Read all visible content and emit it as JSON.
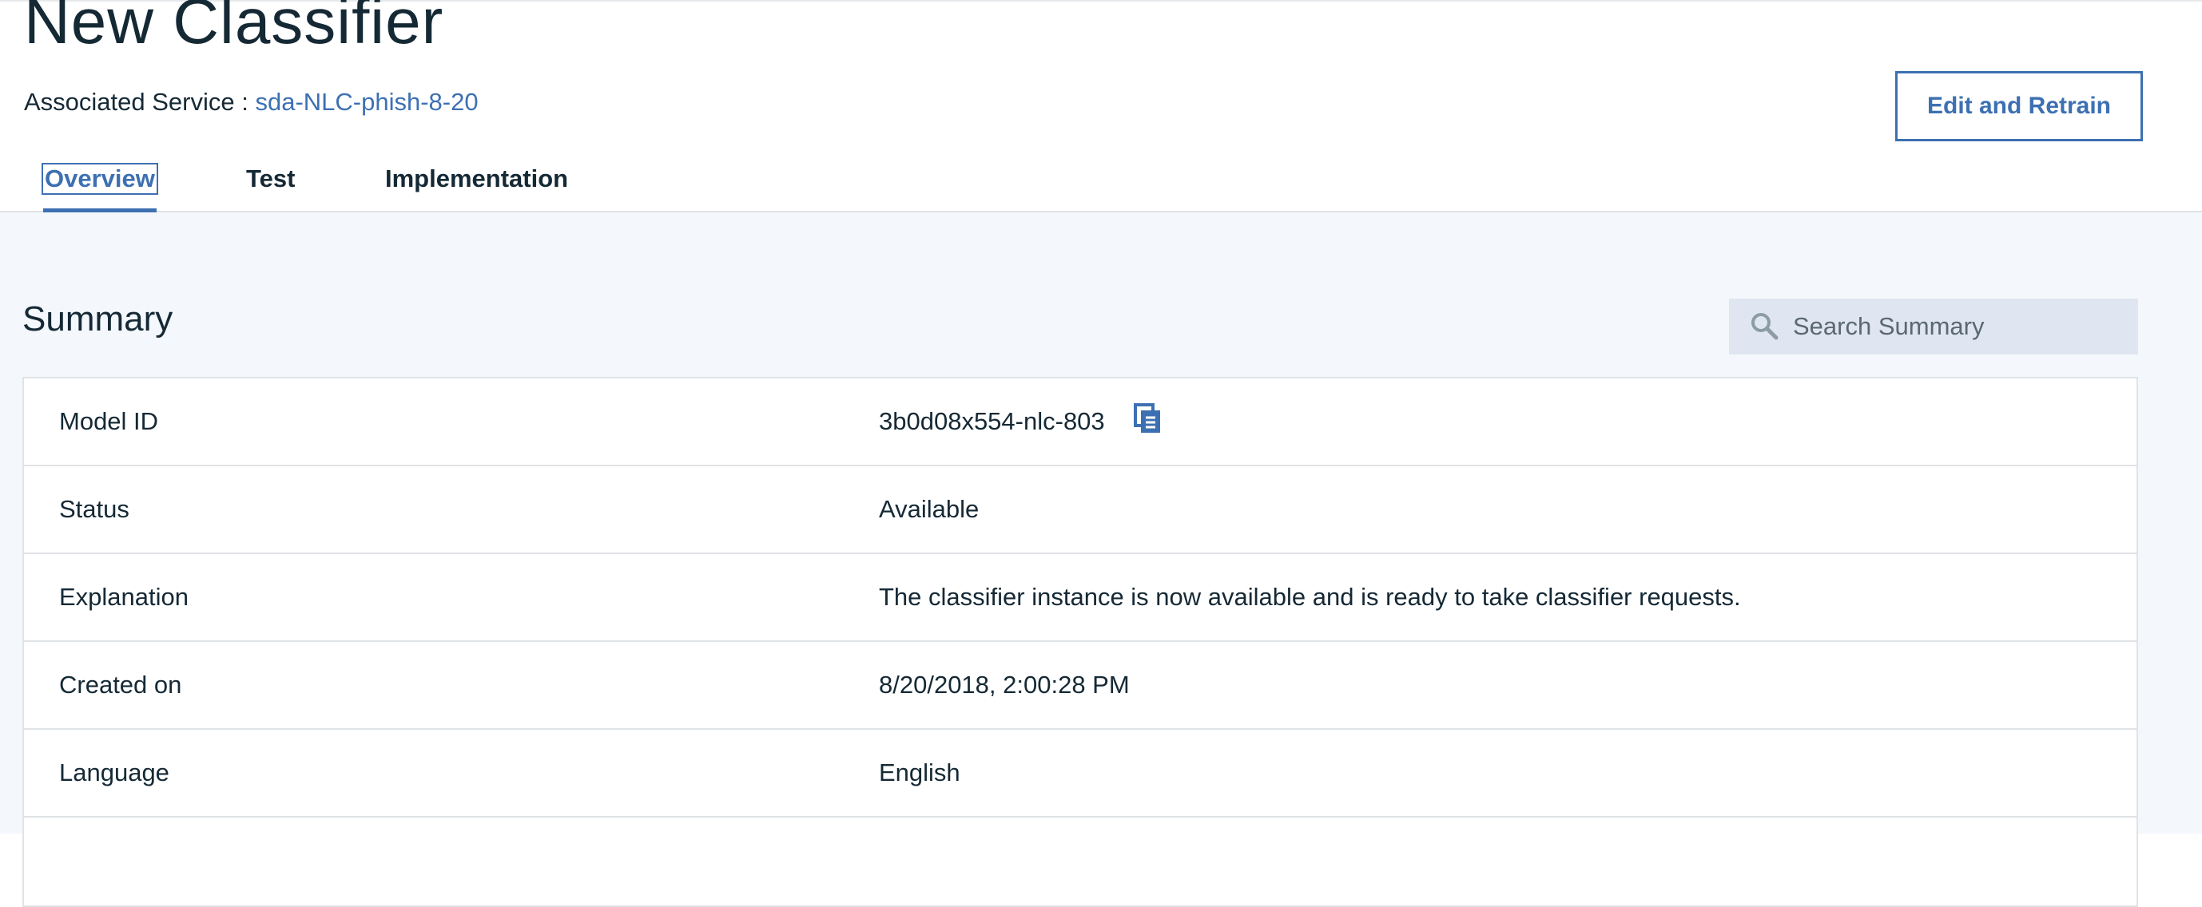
{
  "header": {
    "title": "New Classifier",
    "associated_service_label": "Associated Service : ",
    "associated_service_value": "sda-NLC-phish-8-20",
    "edit_button_label": "Edit and Retrain"
  },
  "tabs": [
    {
      "label": "Overview",
      "active": true
    },
    {
      "label": "Test",
      "active": false
    },
    {
      "label": "Implementation",
      "active": false
    }
  ],
  "summary": {
    "title": "Summary",
    "search_placeholder": "Search Summary",
    "search_icon": "search-icon",
    "copy_icon": "copy-icon",
    "rows": [
      {
        "label": "Model ID",
        "value": "3b0d08x554-nlc-803"
      },
      {
        "label": "Status",
        "value": "Available"
      },
      {
        "label": "Explanation",
        "value": "The classifier instance is now available and is ready to take classifier requests."
      },
      {
        "label": "Created on",
        "value": "8/20/2018, 2:00:28 PM"
      },
      {
        "label": "Language",
        "value": "English"
      },
      {
        "label": "",
        "value": ""
      }
    ]
  },
  "colors": {
    "accent": "#3d70b2",
    "text": "#152935",
    "content_bg": "#f4f7fb",
    "search_bg": "#dfe6f1",
    "border": "#dfe3e6"
  }
}
